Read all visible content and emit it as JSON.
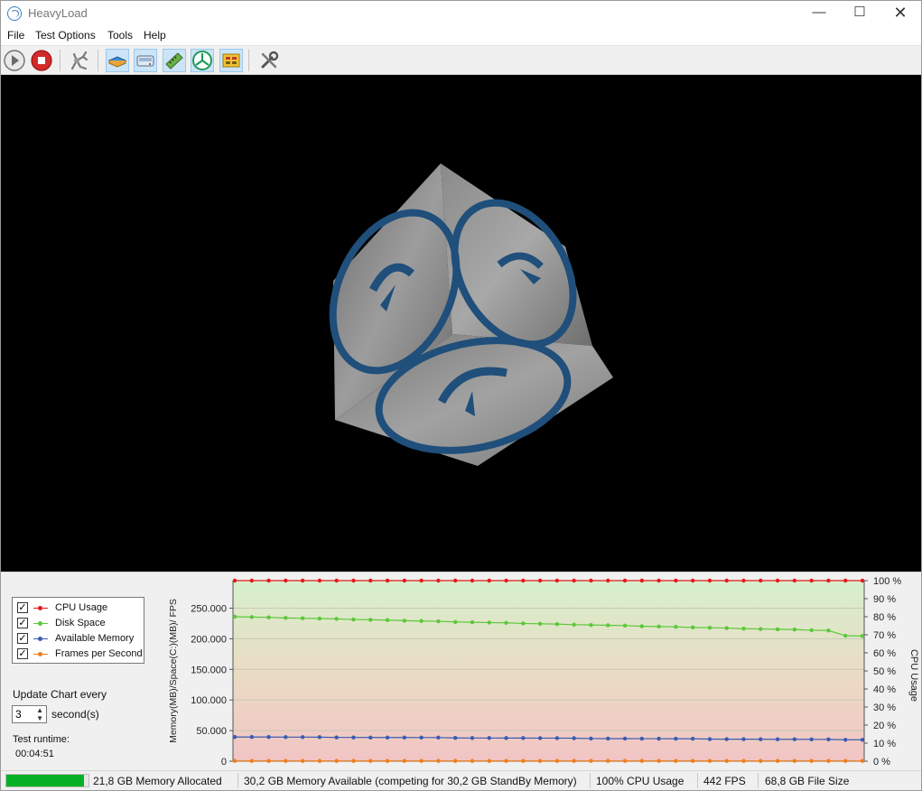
{
  "window": {
    "title": "HeavyLoad"
  },
  "menu": [
    "File",
    "Test Options",
    "Tools",
    "Help"
  ],
  "toolbar": {
    "buttons": [
      {
        "name": "start-icon"
      },
      {
        "name": "stop-icon"
      },
      {
        "name": "cleanup-icon"
      },
      {
        "name": "cpu-load-icon"
      },
      {
        "name": "disk-write-icon"
      },
      {
        "name": "memory-icon"
      },
      {
        "name": "gpu-icon"
      },
      {
        "name": "cpu-cores-icon"
      },
      {
        "name": "options-icon"
      }
    ]
  },
  "legend": {
    "items": [
      {
        "label": "CPU Usage",
        "color": "#e41a1a",
        "checked": true
      },
      {
        "label": "Disk Space",
        "color": "#5cc73a",
        "checked": true
      },
      {
        "label": "Available Memory",
        "color": "#3a5bb0",
        "checked": true
      },
      {
        "label": "Frames per Second",
        "color": "#f07d18",
        "checked": true
      }
    ]
  },
  "update": {
    "label": "Update Chart every",
    "value": "3",
    "unit": "second(s)"
  },
  "runtime": {
    "label": "Test runtime:",
    "value": "00:04:51"
  },
  "chart_data": {
    "type": "line",
    "ylabel_left": "Memory(MB)/Space(C:)(MB)/ FPS",
    "ylabel_right": "CPU Usage",
    "left_ticks": [
      "250.000",
      "200.000",
      "150.000",
      "100.000",
      "50.000",
      "0"
    ],
    "left_tick_values": [
      250000,
      200000,
      150000,
      100000,
      50000,
      0
    ],
    "right_ticks": [
      "100 %",
      "90 %",
      "80 %",
      "70 %",
      "60 %",
      "50 %",
      "40 %",
      "30 %",
      "20 %",
      "10 %",
      "0 %"
    ],
    "ylim_left": [
      0,
      295000
    ],
    "ylim_right": [
      0,
      100
    ],
    "series": [
      {
        "name": "CPU Usage",
        "axis": "right",
        "color": "#e41a1a",
        "values": [
          100,
          100,
          100,
          100,
          100,
          100,
          100,
          100,
          100,
          100,
          100,
          100,
          100,
          100,
          100,
          100,
          100,
          100,
          100,
          100,
          100,
          100,
          100,
          100,
          100,
          100,
          100,
          100,
          100,
          100,
          100,
          100,
          100,
          100,
          100,
          100,
          100,
          100
        ]
      },
      {
        "name": "Disk Space",
        "axis": "left",
        "color": "#5cc73a",
        "values": [
          236000,
          235500,
          235000,
          234000,
          233500,
          233000,
          232500,
          231500,
          231000,
          230500,
          229500,
          229000,
          228500,
          227500,
          227000,
          226500,
          226000,
          225000,
          224500,
          224000,
          223000,
          222500,
          222000,
          221500,
          220500,
          220000,
          219500,
          218500,
          218000,
          217500,
          216500,
          216000,
          215500,
          215000,
          214000,
          213500,
          205000,
          204500
        ]
      },
      {
        "name": "Available Memory",
        "axis": "left",
        "color": "#3a5bb0",
        "values": [
          39500,
          39500,
          39500,
          39400,
          39400,
          39300,
          38800,
          38800,
          38700,
          38700,
          38700,
          38600,
          38600,
          38000,
          37900,
          37900,
          37800,
          37800,
          37700,
          37700,
          37600,
          37000,
          36900,
          36900,
          36800,
          36800,
          36700,
          36700,
          36100,
          36000,
          36000,
          35900,
          35800,
          35800,
          35700,
          35600,
          35000,
          35000
        ]
      },
      {
        "name": "Frames per Second",
        "axis": "left",
        "color": "#f07d18",
        "values": [
          442,
          442,
          442,
          442,
          442,
          442,
          442,
          442,
          442,
          442,
          442,
          442,
          442,
          442,
          442,
          442,
          442,
          442,
          442,
          442,
          442,
          442,
          442,
          442,
          442,
          442,
          442,
          442,
          442,
          442,
          442,
          442,
          442,
          442,
          442,
          442,
          442,
          442
        ]
      }
    ]
  },
  "status": {
    "mem_allocated": "21,8 GB Memory Allocated",
    "mem_available": "30,2 GB Memory Available (competing for 30,2 GB StandBy Memory)",
    "cpu": "100% CPU Usage",
    "fps": "442 FPS",
    "file_size": "68,8 GB File Size",
    "mem_progress": 0.95,
    "progress_color": "#06b025"
  }
}
